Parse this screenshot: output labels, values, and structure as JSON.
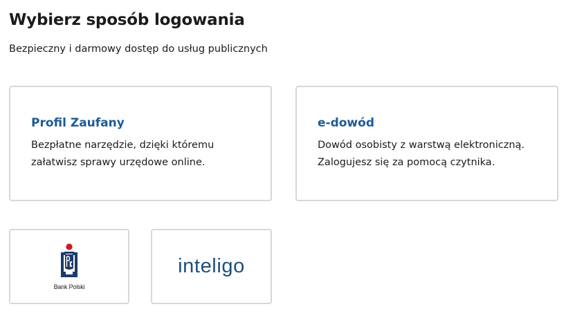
{
  "header": {
    "title": "Wybierz sposób logowania",
    "subtitle": "Bezpieczny i darmowy dostęp do usług publicznych"
  },
  "methods": [
    {
      "title": "Profil Zaufany",
      "description_line1": "Bezpłatne narzędzie, dzięki któremu",
      "description_line2": "załatwisz sprawy urzędowe online."
    },
    {
      "title": "e-dowód",
      "description_line1": "Dowód osobisty z warstwą elektroniczną.",
      "description_line2": "Zalogujesz się za pomocą czytnika."
    }
  ],
  "banks": [
    {
      "name": "Bank Polski",
      "icon": "pko-bp-logo-icon"
    },
    {
      "name": "inteligo",
      "icon": "inteligo-logo-icon"
    }
  ],
  "colors": {
    "heading_blue": "#1d5a98",
    "card_border": "#d7d7d7",
    "pko_navy": "#1b3a6b",
    "pko_red": "#d7142a",
    "inteligo_blue": "#1b4f7d"
  }
}
